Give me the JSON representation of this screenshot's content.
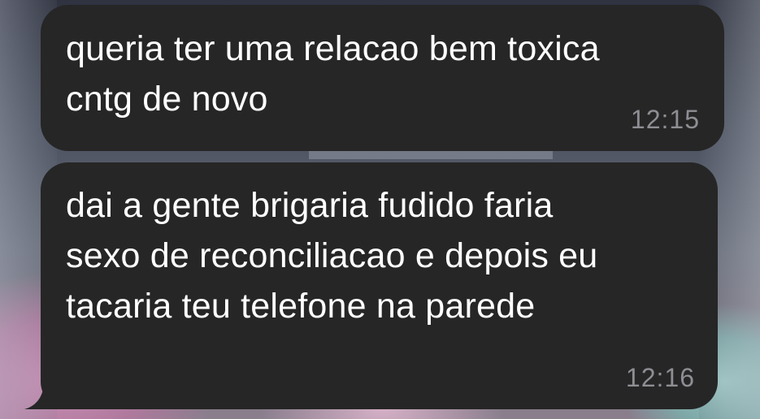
{
  "chat": {
    "messages": [
      {
        "text": "queria ter uma relacao bem toxica\ncntg de novo",
        "time": "12:15",
        "direction": "received"
      },
      {
        "text": "dai a gente brigaria fudido faria\nsexo de reconciliacao e depois eu\ntacaria teu telefone na parede",
        "time": "12:16",
        "direction": "received"
      }
    ]
  },
  "colors": {
    "bubble": "#262626",
    "text": "#ffffff",
    "timestamp": "#8e8e93"
  }
}
